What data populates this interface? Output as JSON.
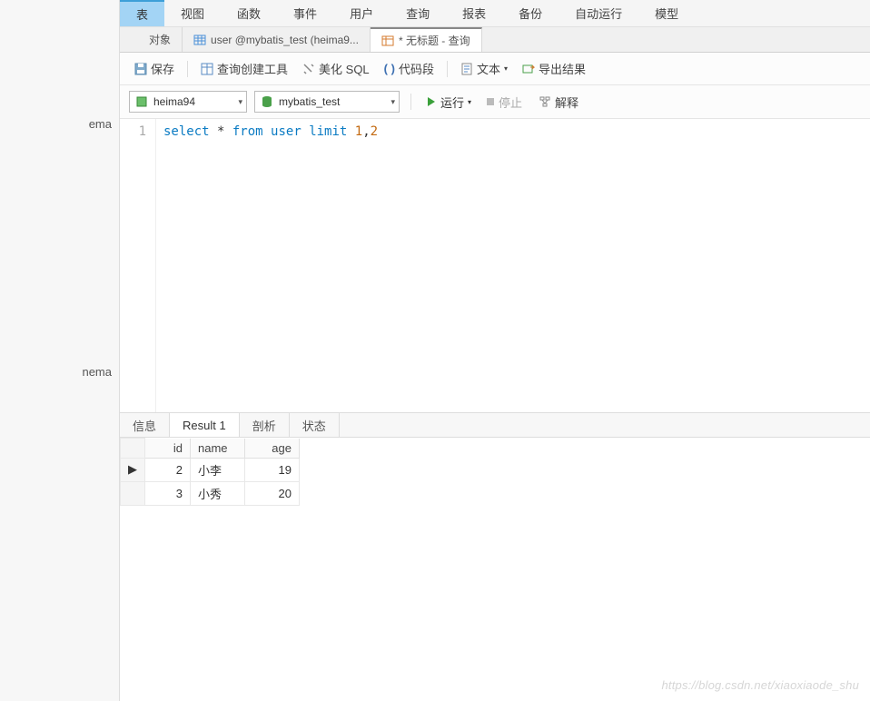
{
  "sidebar": {
    "items": [
      "ema",
      "nema"
    ]
  },
  "top_menu": {
    "items": [
      "表",
      "视图",
      "函数",
      "事件",
      "用户",
      "查询",
      "报表",
      "备份",
      "自动运行",
      "模型"
    ],
    "active_index": 0
  },
  "tabs": {
    "items": [
      {
        "label": "对象",
        "icon": "object"
      },
      {
        "label": "user @mybatis_test (heima9...",
        "icon": "table"
      },
      {
        "label": "* 无标题 - 查询",
        "icon": "query"
      }
    ],
    "active_index": 2
  },
  "toolbar": {
    "save_label": "保存",
    "query_builder_label": "查询创建工具",
    "beautify_label": "美化 SQL",
    "code_snippet_label": "代码段",
    "text_label": "文本",
    "export_label": "导出结果"
  },
  "connection": {
    "conn_dropdown": {
      "value": "heima94"
    },
    "db_dropdown": {
      "value": "mybatis_test"
    },
    "run_label": "运行",
    "stop_label": "停止",
    "explain_label": "解释"
  },
  "editor": {
    "line_number": "1",
    "sql": {
      "kw1": "select",
      "star": " * ",
      "kw2": "from",
      "sp1": " ",
      "tbl": "user",
      "sp2": " ",
      "kw3": "limit",
      "sp3": " ",
      "n1": "1",
      "comma": ",",
      "n2": "2"
    }
  },
  "result_tabs": {
    "items": [
      "信息",
      "Result 1",
      "剖析",
      "状态"
    ],
    "active_index": 1
  },
  "result": {
    "columns": [
      "id",
      "name",
      "age"
    ],
    "rows": [
      {
        "id": "2",
        "name": "小李",
        "age": "19"
      },
      {
        "id": "3",
        "name": "小秀",
        "age": "20"
      }
    ],
    "current_row_marker": "▶"
  },
  "watermark": "https://blog.csdn.net/xiaoxiaode_shu"
}
